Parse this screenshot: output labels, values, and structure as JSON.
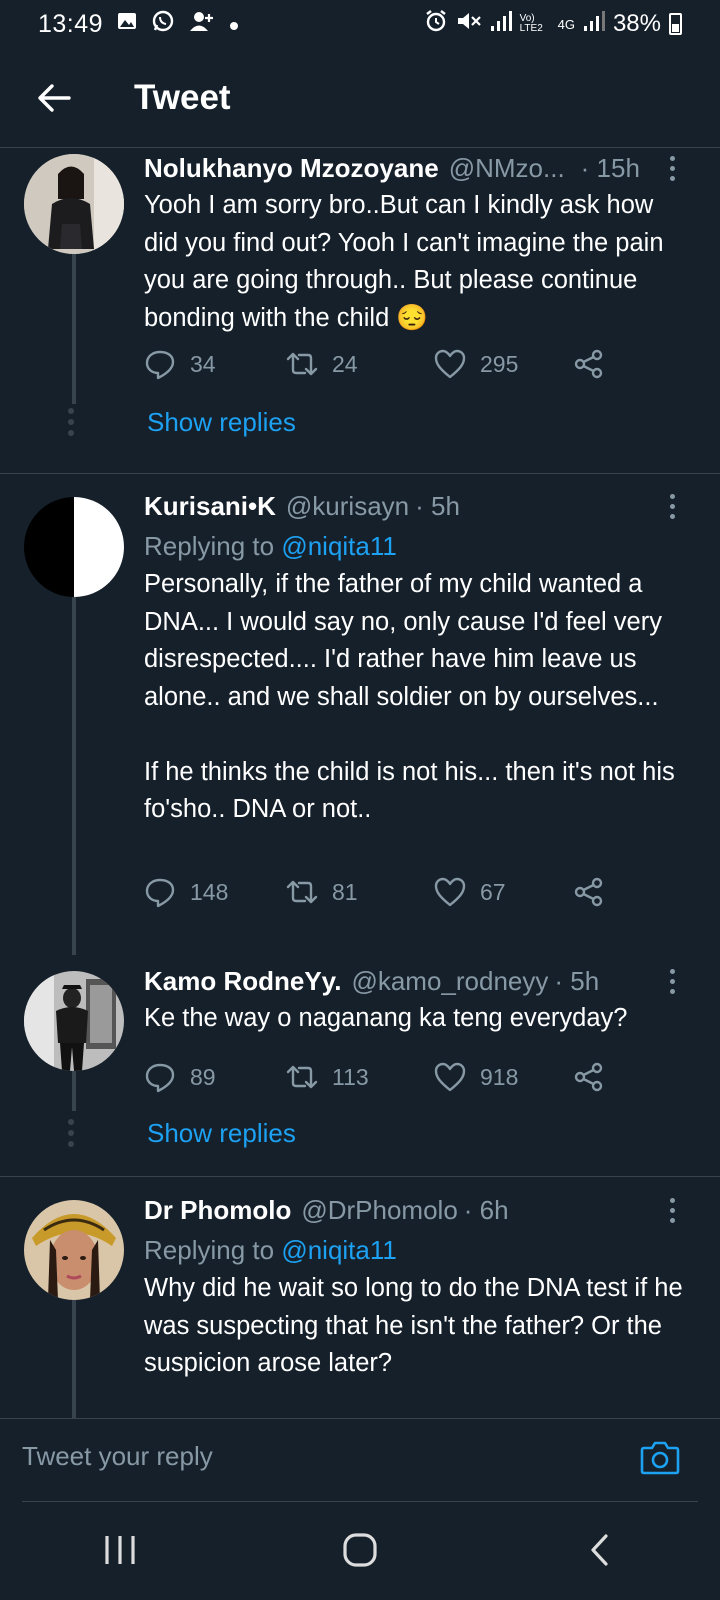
{
  "status_bar": {
    "time": "13:49",
    "battery": "38%",
    "network_label": "Vo) LTE2",
    "network_type": "4G"
  },
  "header": {
    "title": "Tweet"
  },
  "tweets": [
    {
      "name": "Nolukhanyo Mzozoyane",
      "handle": "@NMzo...",
      "time": "· 15h",
      "replying_to": "",
      "text": "Yooh I am sorry bro..But can I kindly ask how did you find out? Yooh I can't imagine the pain you are going through.. But please continue bonding with the child 😔",
      "replies": "34",
      "retweets": "24",
      "likes": "295",
      "show_replies": "Show replies"
    },
    {
      "name": "Kurisani•K",
      "handle": "@kurisayn",
      "time": "· 5h",
      "replying_prefix": "Replying to ",
      "replying_to": "@niqita11",
      "text": "Personally, if the father of my child wanted a DNA... I would say no, only cause I'd feel very disrespected.... I'd rather have him leave us alone.. and we shall soldier on by ourselves...\n\nIf he thinks the child is not his... then it's not his fo'sho.. DNA or not..",
      "replies": "148",
      "retweets": "81",
      "likes": "67"
    },
    {
      "name": "Kamo RodneYy.",
      "handle": "@kamo_rodneyy",
      "time": "· 5h",
      "text": "Ke the way o naganang ka teng everyday?",
      "replies": "89",
      "retweets": "113",
      "likes": "918",
      "show_replies": "Show replies"
    },
    {
      "name": "Dr Phomolo",
      "handle": "@DrPhomolo",
      "time": "· 6h",
      "replying_prefix": "Replying to ",
      "replying_to": "@niqita11",
      "text": "Why did he wait so long to do the DNA test if he was suspecting that he isn't the father? Or the suspicion arose later?"
    }
  ],
  "composer": {
    "placeholder": "Tweet your reply"
  },
  "colors": {
    "background": "#15202b",
    "accent": "#1da1f2",
    "muted": "#8899a6",
    "divider": "#38444d"
  }
}
